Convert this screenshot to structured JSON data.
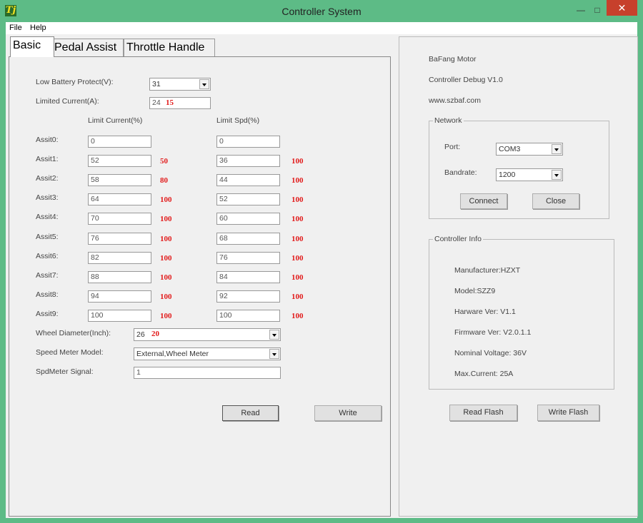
{
  "window": {
    "title": "Controller System",
    "min_label": "—",
    "max_label": "□",
    "close_label": "✕",
    "icon_text": "Tj"
  },
  "menu": {
    "file": "File",
    "help": "Help"
  },
  "tabs": [
    {
      "label": "Basic"
    },
    {
      "label": "Pedal Assist"
    },
    {
      "label": "Throttle Handle"
    }
  ],
  "basic": {
    "low_battery_label": "Low Battery Protect(V):",
    "low_battery_value": "31",
    "limited_current_label": "Limited Current(A):",
    "limited_current_value": "24",
    "limited_current_note": "15",
    "col_current_header": "Limit Current(%)",
    "col_speed_header": "Limit Spd(%)",
    "assist_rows": [
      {
        "label": "Assit0:",
        "current": "0",
        "current_note": "",
        "speed": "0",
        "speed_note": ""
      },
      {
        "label": "Assit1:",
        "current": "52",
        "current_note": "50",
        "speed": "36",
        "speed_note": "100"
      },
      {
        "label": "Assit2:",
        "current": "58",
        "current_note": "80",
        "speed": "44",
        "speed_note": "100"
      },
      {
        "label": "Assit3:",
        "current": "64",
        "current_note": "100",
        "speed": "52",
        "speed_note": "100"
      },
      {
        "label": "Assit4:",
        "current": "70",
        "current_note": "100",
        "speed": "60",
        "speed_note": "100"
      },
      {
        "label": "Assit5:",
        "current": "76",
        "current_note": "100",
        "speed": "68",
        "speed_note": "100"
      },
      {
        "label": "Assit6:",
        "current": "82",
        "current_note": "100",
        "speed": "76",
        "speed_note": "100"
      },
      {
        "label": "Assit7:",
        "current": "88",
        "current_note": "100",
        "speed": "84",
        "speed_note": "100"
      },
      {
        "label": "Assit8:",
        "current": "94",
        "current_note": "100",
        "speed": "92",
        "speed_note": "100"
      },
      {
        "label": "Assit9:",
        "current": "100",
        "current_note": "100",
        "speed": "100",
        "speed_note": "100"
      }
    ],
    "wheel_label": "Wheel Diameter(Inch):",
    "wheel_value": "26",
    "wheel_note": "20",
    "speed_meter_label": "Speed Meter Model:",
    "speed_meter_value": "External,Wheel Meter",
    "spd_signal_label": "SpdMeter Signal:",
    "spd_signal_value": "1",
    "read_button": "Read",
    "write_button": "Write"
  },
  "info": {
    "brand": "BaFang Motor",
    "debug_version": "Controller Debug V1.0",
    "website": "www.szbaf.com",
    "network_title": "Network",
    "port_label": "Port:",
    "port_value": "COM3",
    "baud_label": "Bandrate:",
    "baud_value": "1200",
    "connect_button": "Connect",
    "close_button": "Close",
    "controller_info_title": "Controller Info",
    "manufacturer": "Manufacturer:HZXT",
    "model": "Model:SZZ9",
    "hardware_ver": "Harware Ver: V1.1",
    "firmware_ver": "Firmware Ver: V2.0.1.1",
    "nominal_voltage": "Nominal Voltage: 36V",
    "max_current": "Max.Current: 25A",
    "read_flash_button": "Read Flash",
    "write_flash_button": "Write Flash"
  },
  "colors": {
    "title_bar": "#5dbb86",
    "close_button": "#c7402c",
    "annotation_red": "#e21b1b"
  }
}
